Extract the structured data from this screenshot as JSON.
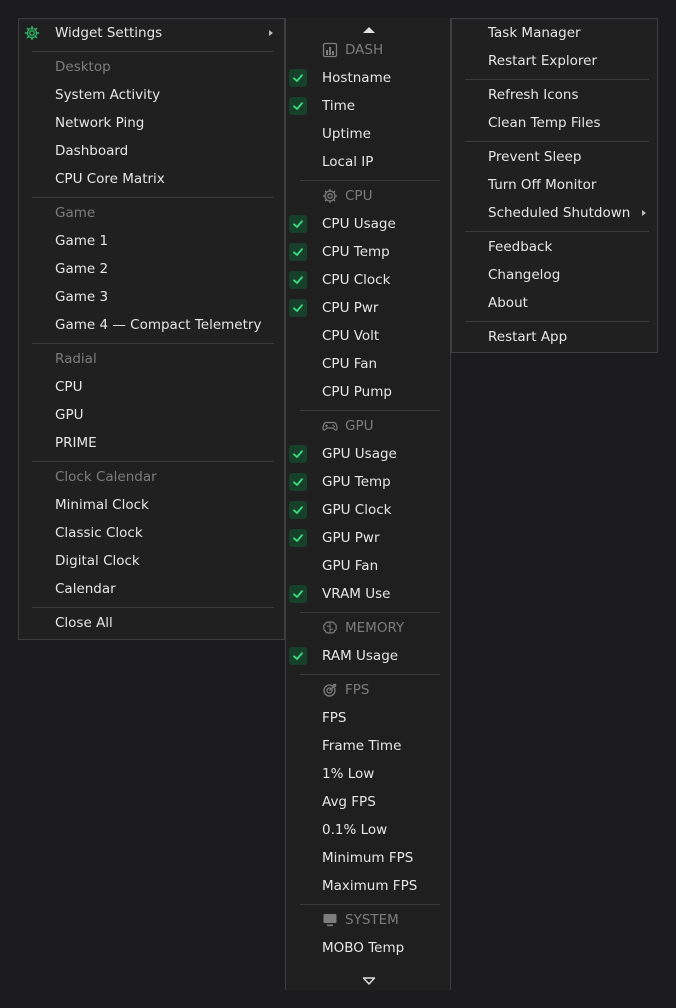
{
  "left_menu": {
    "widget_settings": "Widget Settings",
    "sections": [
      {
        "header": "Desktop",
        "items": [
          "System Activity",
          "Network  Ping",
          "Dashboard",
          "CPU Core Matrix"
        ]
      },
      {
        "header": "Game",
        "items": [
          "Game 1",
          "Game 2",
          "Game 3",
          "Game 4 — Compact Telemetry"
        ]
      },
      {
        "header": "Radial",
        "items": [
          "CPU",
          "GPU",
          "PRIME"
        ]
      },
      {
        "header": "Clock  Calendar",
        "items": [
          "Minimal Clock",
          "Classic Clock",
          "Digital Clock",
          "Calendar"
        ]
      }
    ],
    "close_all": "Close All"
  },
  "mid_menu": {
    "categories": [
      {
        "name": "DASH",
        "icon": "bar-chart-icon",
        "items": [
          {
            "label": "Hostname",
            "checked": true
          },
          {
            "label": "Time",
            "checked": true
          },
          {
            "label": "Uptime",
            "checked": false
          },
          {
            "label": "Local IP",
            "checked": false
          }
        ]
      },
      {
        "name": "CPU",
        "icon": "cpu-chip-icon",
        "items": [
          {
            "label": "CPU Usage",
            "checked": true
          },
          {
            "label": "CPU Temp",
            "checked": true
          },
          {
            "label": "CPU Clock",
            "checked": true
          },
          {
            "label": "CPU Pwr",
            "checked": true
          },
          {
            "label": "CPU Volt",
            "checked": false
          },
          {
            "label": "CPU Fan",
            "checked": false
          },
          {
            "label": "CPU Pump",
            "checked": false
          }
        ]
      },
      {
        "name": "GPU",
        "icon": "gamepad-icon",
        "items": [
          {
            "label": "GPU Usage",
            "checked": true
          },
          {
            "label": "GPU Temp",
            "checked": true
          },
          {
            "label": "GPU Clock",
            "checked": true
          },
          {
            "label": "GPU Pwr",
            "checked": true
          },
          {
            "label": "GPU Fan",
            "checked": false
          },
          {
            "label": "VRAM Use",
            "checked": true
          }
        ]
      },
      {
        "name": "MEMORY",
        "icon": "brain-icon",
        "items": [
          {
            "label": "RAM Usage",
            "checked": true
          }
        ]
      },
      {
        "name": "FPS",
        "icon": "target-icon",
        "items": [
          {
            "label": "FPS",
            "checked": false
          },
          {
            "label": "Frame Time",
            "checked": false
          },
          {
            "label": "1% Low",
            "checked": false
          },
          {
            "label": "Avg FPS",
            "checked": false
          },
          {
            "label": "0.1% Low",
            "checked": false
          },
          {
            "label": "Minimum FPS",
            "checked": false
          },
          {
            "label": "Maximum FPS",
            "checked": false
          }
        ]
      },
      {
        "name": "SYSTEM",
        "icon": "monitor-icon",
        "items": [
          {
            "label": "MOBO Temp",
            "checked": false
          }
        ]
      }
    ]
  },
  "right_menu": {
    "groups": [
      [
        "Task Manager",
        "Restart Explorer"
      ],
      [
        "Refresh Icons",
        "Clean Temp Files"
      ],
      [
        "Prevent Sleep",
        "Turn Off Monitor",
        "Scheduled Shutdown"
      ],
      [
        "Feedback",
        "Changelog",
        "About"
      ],
      [
        "Restart App"
      ]
    ],
    "submenu_item": "Scheduled Shutdown"
  },
  "colors": {
    "background": "#1c1c1e",
    "check_bg": "#17402b",
    "check_mark": "#3ddc84",
    "header_text": "#7d7d7d",
    "gear_accent": "#2fbf6a"
  }
}
